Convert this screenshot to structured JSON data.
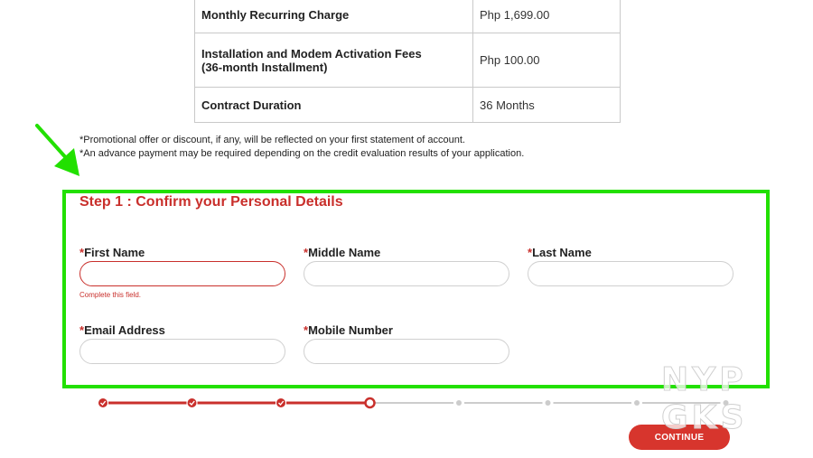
{
  "summary": {
    "rows": [
      {
        "label": "Monthly Recurring Charge",
        "value": "Php 1,699.00"
      },
      {
        "label_line1": "Installation and Modem Activation Fees",
        "label_line2": "(36-month Installment)",
        "value": "Php 100.00"
      },
      {
        "label": "Contract Duration",
        "value": "36 Months"
      }
    ]
  },
  "notes": [
    "*Promotional offer or discount, if any, will be reflected on your first statement of account.",
    "*An advance payment may be required depending on the credit evaluation results of your application."
  ],
  "step": {
    "title": "Step 1 : Confirm your Personal Details"
  },
  "form": {
    "required_mark": "*",
    "first_name": {
      "label": "First Name",
      "value": "",
      "error": "Complete this field."
    },
    "middle_name": {
      "label": "Middle Name",
      "value": ""
    },
    "last_name": {
      "label": "Last Name",
      "value": ""
    },
    "email": {
      "label": "Email Address",
      "value": ""
    },
    "mobile": {
      "label": "Mobile Number",
      "value": ""
    }
  },
  "progress": {
    "total_steps": 8,
    "completed_steps": 3,
    "current_step": 4
  },
  "actions": {
    "continue_label": "CONTINUE"
  },
  "watermark": {
    "line1": "NYP",
    "line2": "GKS"
  },
  "colors": {
    "accent_red": "#c9302c",
    "button_red": "#d7352d",
    "highlight_green": "#22e000",
    "inactive_gray": "#cccccc"
  }
}
